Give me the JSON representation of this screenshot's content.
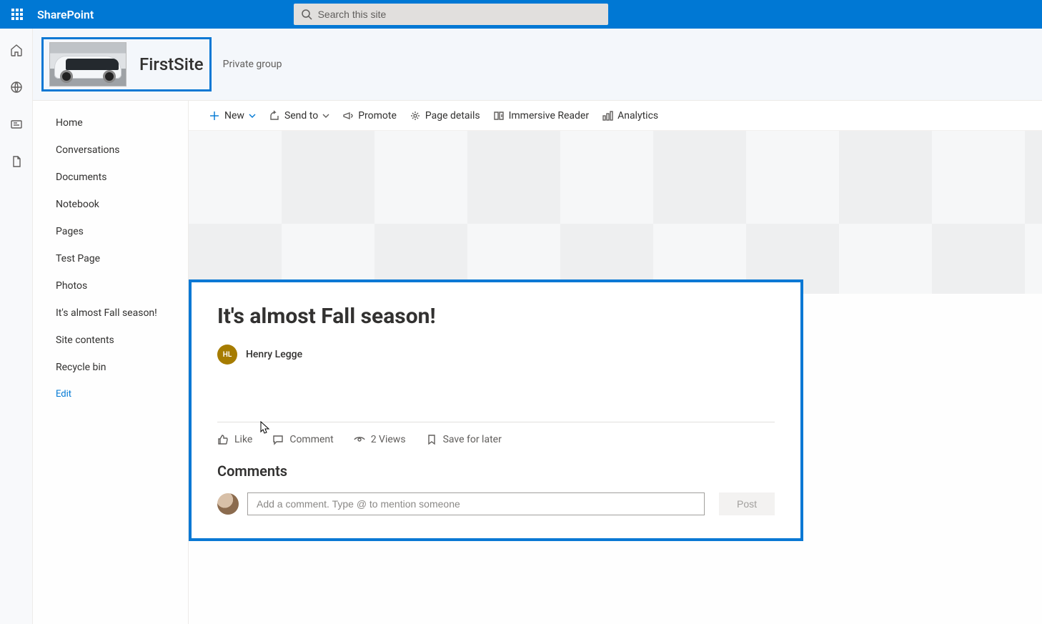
{
  "suite": {
    "brand": "SharePoint"
  },
  "search": {
    "placeholder": "Search this site"
  },
  "site": {
    "title": "FirstSite",
    "privacy": "Private group"
  },
  "nav": {
    "items": [
      {
        "id": "home",
        "label": "Home"
      },
      {
        "id": "conversations",
        "label": "Conversations"
      },
      {
        "id": "documents",
        "label": "Documents"
      },
      {
        "id": "notebook",
        "label": "Notebook"
      },
      {
        "id": "pages",
        "label": "Pages"
      },
      {
        "id": "testpage",
        "label": "Test Page"
      },
      {
        "id": "photos",
        "label": "Photos"
      },
      {
        "id": "fall",
        "label": "It's almost Fall season!"
      },
      {
        "id": "contents",
        "label": "Site contents"
      },
      {
        "id": "recycle",
        "label": "Recycle bin"
      }
    ],
    "edit_label": "Edit"
  },
  "commands": {
    "new": "New",
    "send_to": "Send to",
    "promote": "Promote",
    "page_details": "Page details",
    "immersive": "Immersive Reader",
    "analytics": "Analytics"
  },
  "article": {
    "title": "It's almost Fall season!",
    "author_initials": "HL",
    "author_name": "Henry Legge"
  },
  "actions": {
    "like": "Like",
    "comment": "Comment",
    "views": "2 Views",
    "save": "Save for later"
  },
  "comments": {
    "heading": "Comments",
    "placeholder": "Add a comment. Type @ to mention someone",
    "post_label": "Post"
  }
}
